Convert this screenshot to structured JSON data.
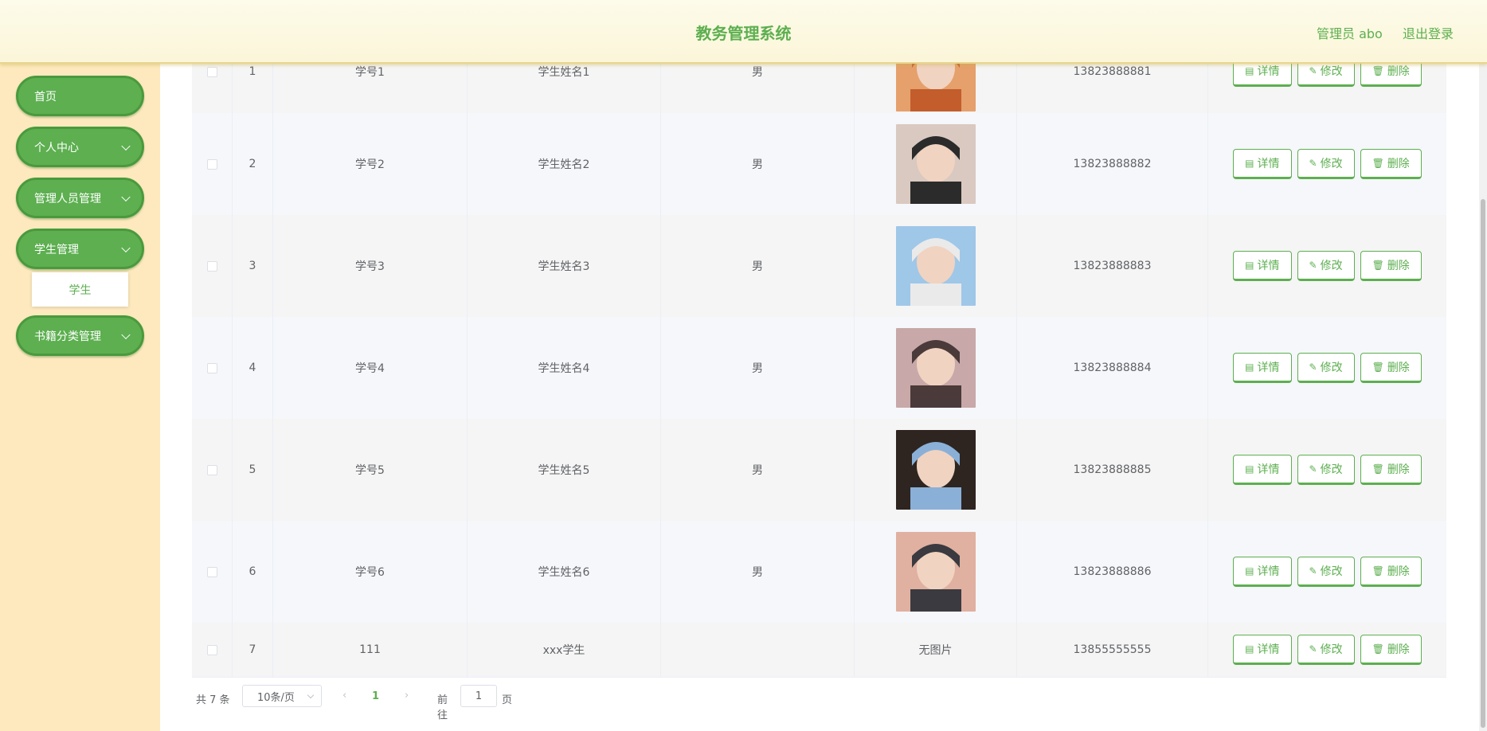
{
  "header": {
    "title": "教务管理系统",
    "user_label": "管理员 abo",
    "logout_label": "退出登录"
  },
  "sidebar": {
    "items": [
      {
        "label": "首页",
        "expandable": false
      },
      {
        "label": "个人中心",
        "expandable": true
      },
      {
        "label": "管理人员管理",
        "expandable": true
      },
      {
        "label": "学生管理",
        "expandable": true,
        "expanded": true,
        "children": [
          "学生"
        ]
      },
      {
        "label": "书籍分类管理",
        "expandable": true
      }
    ]
  },
  "table": {
    "rows": [
      {
        "index": "1",
        "student_no": "学号1",
        "name": "学生姓名1",
        "gender": "男",
        "photo": "photo",
        "phone": "13823888881"
      },
      {
        "index": "2",
        "student_no": "学号2",
        "name": "学生姓名2",
        "gender": "男",
        "photo": "photo",
        "phone": "13823888882"
      },
      {
        "index": "3",
        "student_no": "学号3",
        "name": "学生姓名3",
        "gender": "男",
        "photo": "photo",
        "phone": "13823888883"
      },
      {
        "index": "4",
        "student_no": "学号4",
        "name": "学生姓名4",
        "gender": "男",
        "photo": "photo",
        "phone": "13823888884"
      },
      {
        "index": "5",
        "student_no": "学号5",
        "name": "学生姓名5",
        "gender": "男",
        "photo": "photo",
        "phone": "13823888885"
      },
      {
        "index": "6",
        "student_no": "学号6",
        "name": "学生姓名6",
        "gender": "男",
        "photo": "photo",
        "phone": "13823888886"
      },
      {
        "index": "7",
        "student_no": "111",
        "name": "xxx学生",
        "gender": "",
        "photo_text": "无图片",
        "phone": "13855555555"
      }
    ],
    "actions": {
      "detail": "详情",
      "edit": "修改",
      "delete": "删除"
    }
  },
  "pagination": {
    "total": "共 7 条",
    "page_size": "10条/页",
    "current_page": "1",
    "goto_label": "前往",
    "goto_value": "1",
    "page_suffix": "页"
  },
  "colors": {
    "accent": "#5daf50",
    "sidebar_bg": "#fde9bd",
    "header_bg": "#fdfbea"
  }
}
